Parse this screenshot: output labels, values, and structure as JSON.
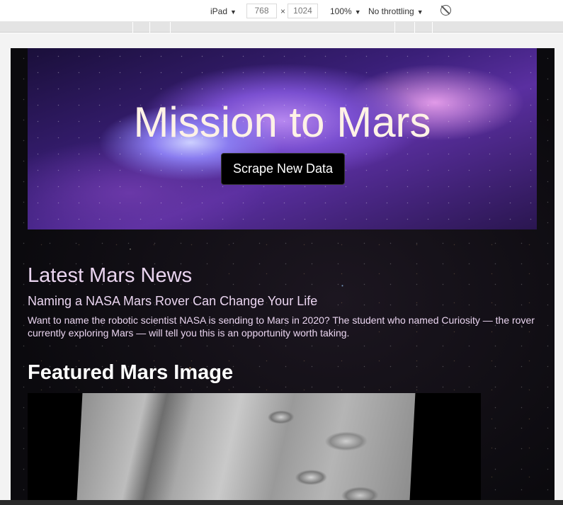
{
  "devtools": {
    "device": "iPad",
    "width": "768",
    "times": "×",
    "height": "1024",
    "zoom": "100%",
    "throttling": "No throttling"
  },
  "page": {
    "title": "Mission to Mars",
    "scrape_button": "Scrape New Data",
    "news_heading": "Latest Mars News",
    "news_title": "Naming a NASA Mars Rover Can Change Your Life",
    "news_paragraph": "Want to name the robotic scientist NASA is sending to Mars in 2020? The student who named Curiosity — the rover currently exploring Mars — will tell you this is an opportunity worth taking.",
    "featured_heading": "Featured Mars Image"
  },
  "colors": {
    "heading": "#ead5f0",
    "button_bg": "#000000"
  }
}
